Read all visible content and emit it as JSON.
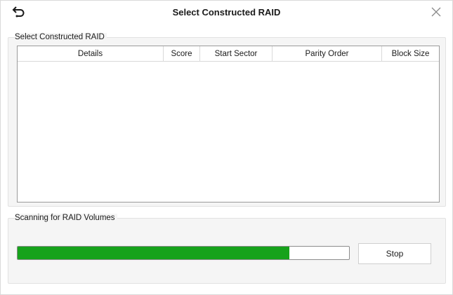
{
  "window": {
    "title": "Select Constructed RAID",
    "back_icon": "back-arrow-icon",
    "close_icon": "close-icon"
  },
  "raid_group": {
    "label": "Select Constructed RAID",
    "columns": [
      "Details",
      "Score",
      "Start Sector",
      "Parity Order",
      "Block Size"
    ],
    "rows": []
  },
  "scan_group": {
    "label": "Scanning for RAID Volumes",
    "progress_fraction": 0.82,
    "progress_color": "#16a21b",
    "stop_label": "Stop"
  }
}
